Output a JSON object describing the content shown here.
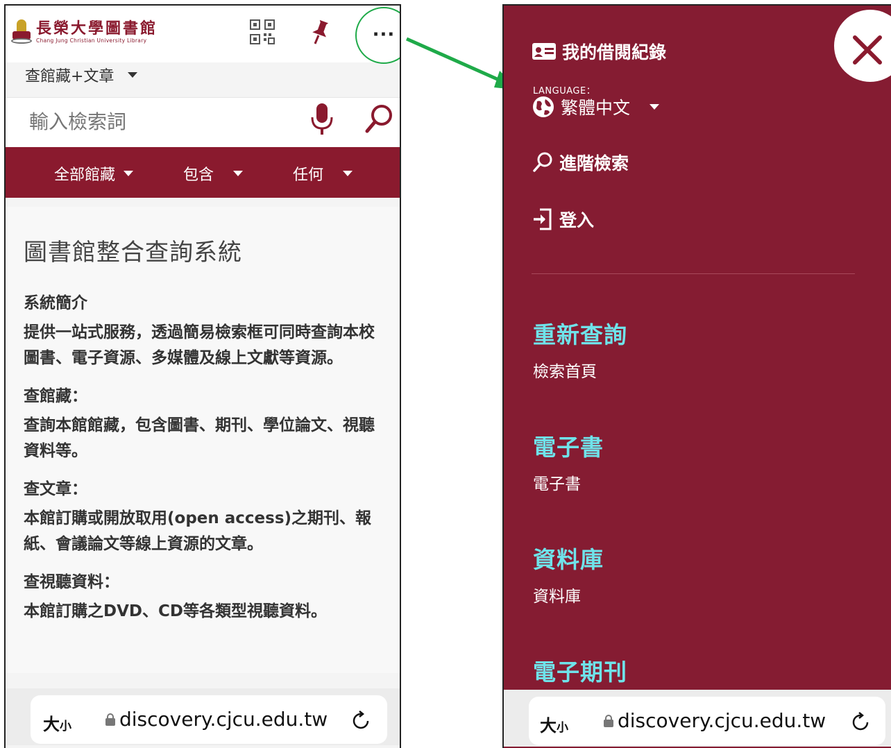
{
  "left": {
    "logo": {
      "title": "長榮大學圖書館",
      "subtitle": "Chang Jung Christian University Library"
    },
    "header_icons": [
      "qr-code-icon",
      "pin-icon",
      "more-icon"
    ],
    "more_label": "···",
    "scope_select": "查館藏+文章",
    "search": {
      "placeholder": "輸入檢索詞"
    },
    "filters": [
      "全部館藏",
      "包含",
      "任何"
    ],
    "page_title": "圖書館整合查詢系統",
    "sections": [
      {
        "heading": "系統簡介",
        "text": "提供一站式服務，透過簡易檢索框可同時查詢本校圖書、電子資源、多媒體及線上文獻等資源。"
      },
      {
        "heading": "查館藏：",
        "text": "查詢本館館藏，包含圖書、期刊、學位論文、視聽資料等。"
      },
      {
        "heading": "查文章：",
        "text": "本館訂購或開放取用(open access)之期刊、報紙、會議論文等線上資源的文章。"
      },
      {
        "heading": "查視聽資料：",
        "text": "本館訂購之DVD、CD等各類型視聽資料。"
      }
    ],
    "browser": {
      "text_size": "大",
      "text_size_small": "小",
      "url": "discovery.cjcu.edu.tw"
    }
  },
  "right": {
    "menu": {
      "my_loans": "我的借閱紀錄",
      "language_label": "LANGUAGE：",
      "language_value": "繁體中文",
      "advanced_search": "進階檢索",
      "login": "登入"
    },
    "sections": [
      {
        "title": "重新查詢",
        "link": "檢索首頁"
      },
      {
        "title": "電子書",
        "link": "電子書"
      },
      {
        "title": "資料庫",
        "link": "資料庫"
      },
      {
        "title": "電子期刊",
        "link": ""
      }
    ],
    "browser": {
      "text_size": "大",
      "text_size_small": "小",
      "url": "discovery.cjcu.edu.tw"
    }
  },
  "colors": {
    "brand_maroon": "#8a1a2e",
    "menu_background": "#851c32",
    "section_title_cyan": "#6fe3ea",
    "annotation_green": "#1faa49"
  }
}
